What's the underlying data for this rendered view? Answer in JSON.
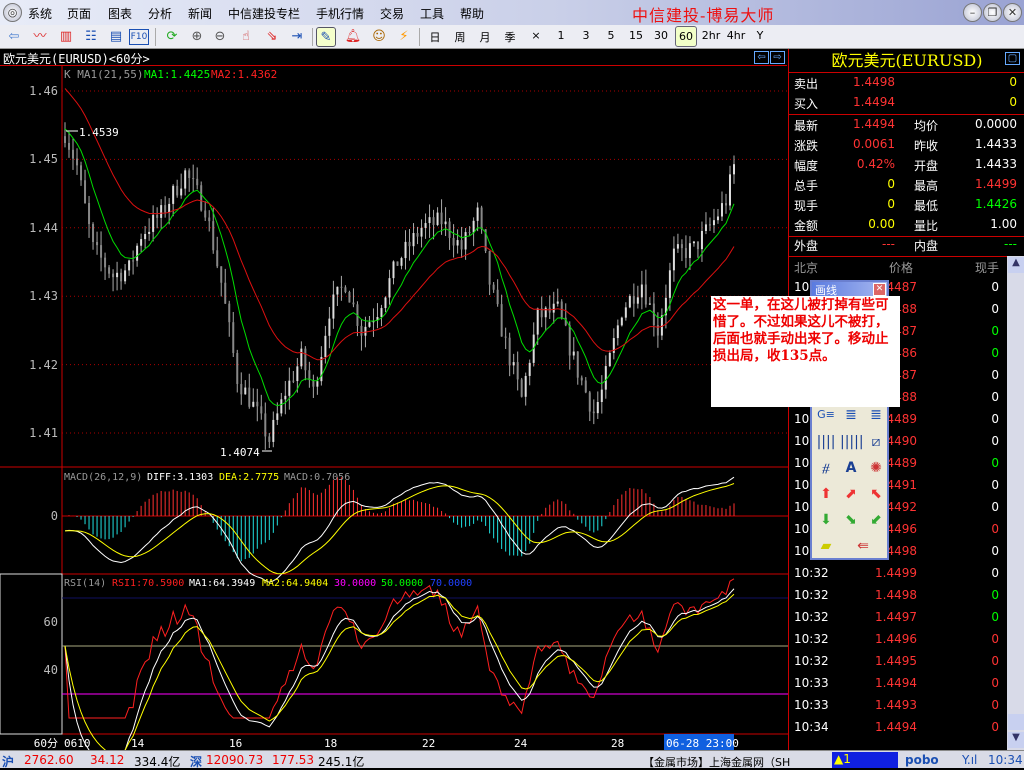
{
  "menu": {
    "items": [
      "系统",
      "页面",
      "图表",
      "分析",
      "新闻",
      "中信建投专栏",
      "手机行情",
      "交易",
      "工具",
      "帮助"
    ]
  },
  "app_title": "中信建投-博易大师",
  "toolbar": {
    "icons": [
      "back-icon",
      "line-chart-icon",
      "kline-chart-icon",
      "table-icon",
      "window-icon",
      "f10-icon",
      "refresh-icon",
      "zoom-in-icon",
      "zoom-out-icon",
      "select-icon",
      "export-icon",
      "sidebar-icon",
      "draw-icon",
      "alarm-icon",
      "users-icon",
      "flash-icon"
    ],
    "f10_label": "F10",
    "periods": [
      "日",
      "周",
      "月",
      "季",
      "×",
      "1",
      "3",
      "5",
      "15",
      "30",
      "60",
      "2hr",
      "4hr",
      "Y"
    ],
    "selected_period": "60"
  },
  "chart": {
    "title": "欧元美元(EURUSD)<60分>",
    "price_legend": {
      "label": "K  MA1(21,55)",
      "ma1": "MA1:1.4425",
      "ma2": "MA2:1.4362"
    },
    "price_axis": [
      "1.46",
      "1.45",
      "1.44",
      "1.43",
      "1.42",
      "1.41"
    ],
    "annotations": {
      "high": "1.4539",
      "low": "1.4074"
    },
    "macd_legend": {
      "label": "MACD(26,12,9)",
      "diff": "DIFF:3.1303",
      "dea": "DEA:2.7775",
      "macd": "MACD:0.7056"
    },
    "macd_axis": [
      "0"
    ],
    "rsi_legend": {
      "label": "RSI(14)",
      "rsi1": "RSI1:70.5900",
      "ma1": "MA1:64.3949",
      "ma2": "MA2:64.9404",
      "l30": "30.0000",
      "l50": "50.0000",
      "l70": "70.0000"
    },
    "rsi_axis": [
      "60",
      "40"
    ],
    "period_label": "60分",
    "x_axis": [
      "0610",
      "14",
      "16",
      "18",
      "22",
      "24",
      "28"
    ],
    "cursor_time": "06-28 23:00"
  },
  "chart_data": {
    "type": "candlestick",
    "title": "欧元美元(EURUSD)<60分>",
    "ylim": [
      1.405,
      1.463
    ],
    "bars": 168,
    "price_keypoints": [
      [
        0,
        1.4539
      ],
      [
        3,
        1.449
      ],
      [
        7,
        1.437
      ],
      [
        12,
        1.433
      ],
      [
        16,
        1.434
      ],
      [
        19,
        1.439
      ],
      [
        24,
        1.442
      ],
      [
        30,
        1.448
      ],
      [
        35,
        1.443
      ],
      [
        39,
        1.432
      ],
      [
        43,
        1.418
      ],
      [
        47,
        1.414
      ],
      [
        51,
        1.409
      ],
      [
        55,
        1.416
      ],
      [
        59,
        1.421
      ],
      [
        62,
        1.416
      ],
      [
        66,
        1.428
      ],
      [
        70,
        1.432
      ],
      [
        74,
        1.425
      ],
      [
        78,
        1.428
      ],
      [
        83,
        1.435
      ],
      [
        89,
        1.44
      ],
      [
        94,
        1.441
      ],
      [
        99,
        1.437
      ],
      [
        103,
        1.442
      ],
      [
        106,
        1.432
      ],
      [
        110,
        1.423
      ],
      [
        114,
        1.415
      ],
      [
        118,
        1.427
      ],
      [
        123,
        1.428
      ],
      [
        128,
        1.419
      ],
      [
        132,
        1.413
      ],
      [
        134,
        1.416
      ],
      [
        139,
        1.428
      ],
      [
        144,
        1.432
      ],
      [
        148,
        1.425
      ],
      [
        152,
        1.436
      ],
      [
        157,
        1.437
      ],
      [
        162,
        1.441
      ],
      [
        165,
        1.444
      ],
      [
        167,
        1.449
      ]
    ],
    "macd_ylim": [
      -5,
      5
    ],
    "rsi_ylim": [
      20,
      78
    ],
    "rsi_levels": [
      30,
      50,
      70
    ]
  },
  "quote": {
    "title": "欧元美元(EURUSD)",
    "sell": {
      "label": "卖出",
      "price": "1.4498",
      "vol": "0"
    },
    "buy": {
      "label": "买入",
      "price": "1.4494",
      "vol": "0"
    },
    "stats": [
      {
        "l1": "最新",
        "v1": "1.4494",
        "c1": "#ff3333",
        "l2": "均价",
        "v2": "0.0000",
        "c2": "#ffffff"
      },
      {
        "l1": "涨跌",
        "v1": "0.0061",
        "c1": "#ff3333",
        "l2": "昨收",
        "v2": "1.4433",
        "c2": "#ffffff"
      },
      {
        "l1": "幅度",
        "v1": "0.42%",
        "c1": "#ff3333",
        "l2": "开盘",
        "v2": "1.4433",
        "c2": "#ffffff"
      },
      {
        "l1": "总手",
        "v1": "0",
        "c1": "#ffff00",
        "l2": "最高",
        "v2": "1.4499",
        "c2": "#ff3333"
      },
      {
        "l1": "现手",
        "v1": "0",
        "c1": "#ffff00",
        "l2": "最低",
        "v2": "1.4426",
        "c2": "#00ff00"
      },
      {
        "l1": "金额",
        "v1": "0.00",
        "c1": "#ffff00",
        "l2": "量比",
        "v2": "1.00",
        "c2": "#ffffff"
      }
    ],
    "outer": {
      "label": "外盘",
      "value": "---"
    },
    "inner": {
      "label": "内盘",
      "value": "---"
    },
    "tick_headers": [
      "北京",
      "价格",
      "现手"
    ],
    "ticks": [
      {
        "t": "10:",
        "p": "1.4487",
        "v": "0",
        "c": "#ffffff"
      },
      {
        "t": "10:",
        "p": "1.4488",
        "v": "0",
        "c": "#ffffff"
      },
      {
        "t": "10:",
        "p": "1.4487",
        "v": "0",
        "c": "#00ff00"
      },
      {
        "t": "10:",
        "p": "1.4486",
        "v": "0",
        "c": "#00ff00"
      },
      {
        "t": "10:",
        "p": "1.4487",
        "v": "0",
        "c": "#ffffff"
      },
      {
        "t": "10:",
        "p": "1.4488",
        "v": "0",
        "c": "#ffffff"
      },
      {
        "t": "10:",
        "p": "1.4489",
        "v": "0",
        "c": "#ffffff"
      },
      {
        "t": "10:",
        "p": "1.4490",
        "v": "0",
        "c": "#ffffff"
      },
      {
        "t": "10:",
        "p": "1.4489",
        "v": "0",
        "c": "#00ff00"
      },
      {
        "t": "10:",
        "p": "1.4491",
        "v": "0",
        "c": "#ffffff"
      },
      {
        "t": "10:",
        "p": "1.4492",
        "v": "0",
        "c": "#ffffff"
      },
      {
        "t": "10:",
        "p": "1.4496",
        "v": "0",
        "c": "#ff3333"
      },
      {
        "t": "10:",
        "p": "1.4498",
        "v": "0",
        "c": "#ffffff"
      },
      {
        "t": "10:32",
        "p": "1.4499",
        "v": "0",
        "c": "#ffffff"
      },
      {
        "t": "10:32",
        "p": "1.4498",
        "v": "0",
        "c": "#00ff00"
      },
      {
        "t": "10:32",
        "p": "1.4497",
        "v": "0",
        "c": "#00ff00"
      },
      {
        "t": "10:32",
        "p": "1.4496",
        "v": "0",
        "c": "#ff3333"
      },
      {
        "t": "10:32",
        "p": "1.4495",
        "v": "0",
        "c": "#ff3333"
      },
      {
        "t": "10:33",
        "p": "1.4494",
        "v": "0",
        "c": "#ff3333"
      },
      {
        "t": "10:33",
        "p": "1.4493",
        "v": "0",
        "c": "#ff3333"
      },
      {
        "t": "10:34",
        "p": "1.4494",
        "v": "0",
        "c": "#ff3333"
      }
    ]
  },
  "draw_panel": {
    "title": "画线",
    "tools": [
      "g-line-icon",
      "percent-line-icon",
      "percent-line2-icon",
      "cycle-line-icon",
      "fib-cycle-icon",
      "gann-fan-icon",
      "speed-line-icon",
      "text-icon",
      "gann-wheel-icon",
      "up-arrow-icon",
      "up-right-arrow-icon",
      "up-left-arrow-icon",
      "down-arrow-icon",
      "down-right-arrow-icon",
      "down-left-arrow-icon",
      "eraser-icon",
      "settings-icon"
    ],
    "text_label": "A"
  },
  "note": "这一单，在这儿被打掉有些可惜了。不过如果这儿不被打，后面也就手动出来了。移动止损出局，收135点。",
  "status": {
    "sh_label": "沪",
    "sh_index": "2762.60",
    "sh_change": "34.12",
    "sh_amount": "334.4亿",
    "sz_label": "深",
    "sz_index": "12090.73",
    "sz_change": "177.53",
    "sz_amount": "245.1亿",
    "ticker": "【金属市场】上海金属网（SH",
    "alert": "▲1",
    "brand": "pobo",
    "time": "10:34"
  }
}
